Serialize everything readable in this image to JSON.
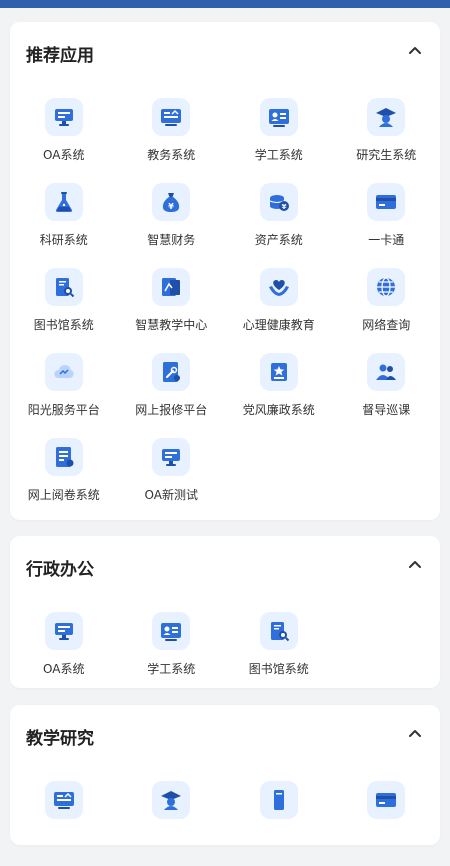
{
  "sections": [
    {
      "title": "推荐应用",
      "apps": [
        {
          "label": "OA系统",
          "icon": "monitor-icon"
        },
        {
          "label": "教务系统",
          "icon": "board-icon"
        },
        {
          "label": "学工系统",
          "icon": "id-card-icon"
        },
        {
          "label": "研究生系统",
          "icon": "graduate-icon"
        },
        {
          "label": "科研系统",
          "icon": "flask-icon"
        },
        {
          "label": "智慧财务",
          "icon": "money-bag-icon"
        },
        {
          "label": "资产系统",
          "icon": "coins-icon"
        },
        {
          "label": "一卡通",
          "icon": "card-icon"
        },
        {
          "label": "图书馆系统",
          "icon": "library-icon"
        },
        {
          "label": "智慧教学中心",
          "icon": "teaching-icon"
        },
        {
          "label": "心理健康教育",
          "icon": "heart-hands-icon"
        },
        {
          "label": "网络查询",
          "icon": "globe-icon"
        },
        {
          "label": "阳光服务平台",
          "icon": "cloud-icon"
        },
        {
          "label": "网上报修平台",
          "icon": "repair-icon"
        },
        {
          "label": "党风廉政系统",
          "icon": "badge-icon"
        },
        {
          "label": "督导巡课",
          "icon": "people-icon"
        },
        {
          "label": "网上阅卷系统",
          "icon": "exam-paper-icon"
        },
        {
          "label": "OA新测试",
          "icon": "monitor-icon"
        }
      ]
    },
    {
      "title": "行政办公",
      "apps": [
        {
          "label": "OA系统",
          "icon": "monitor-icon"
        },
        {
          "label": "学工系统",
          "icon": "id-card-icon"
        },
        {
          "label": "图书馆系统",
          "icon": "library-icon"
        }
      ]
    },
    {
      "title": "教学研究",
      "apps": [
        {
          "label": "",
          "icon": "board-icon"
        },
        {
          "label": "",
          "icon": "graduate-icon"
        },
        {
          "label": "",
          "icon": "book-icon"
        },
        {
          "label": "",
          "icon": "card-icon"
        }
      ]
    }
  ],
  "colors": {
    "accent": "#2f6fdc",
    "accent_dark": "#1f4fa8",
    "icon_bg": "#e8f1ff"
  }
}
